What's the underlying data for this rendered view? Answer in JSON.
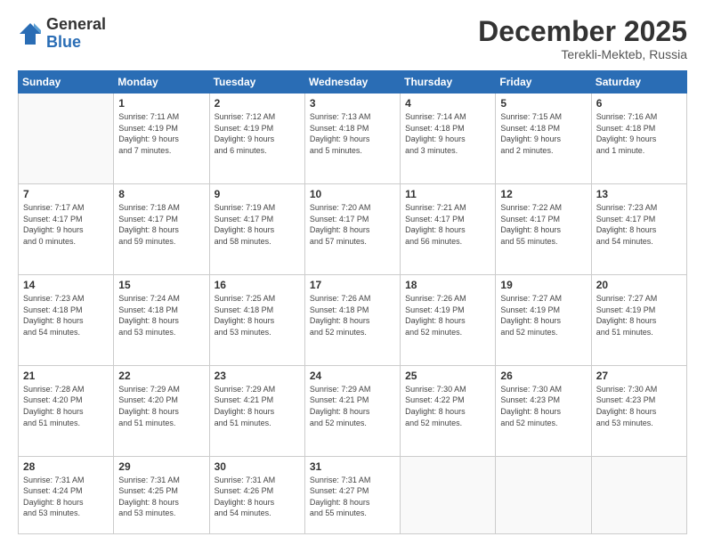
{
  "header": {
    "logo_general": "General",
    "logo_blue": "Blue",
    "month_title": "December 2025",
    "location": "Terekli-Mekteb, Russia"
  },
  "days_of_week": [
    "Sunday",
    "Monday",
    "Tuesday",
    "Wednesday",
    "Thursday",
    "Friday",
    "Saturday"
  ],
  "weeks": [
    [
      {
        "day": "",
        "info": ""
      },
      {
        "day": "1",
        "info": "Sunrise: 7:11 AM\nSunset: 4:19 PM\nDaylight: 9 hours\nand 7 minutes."
      },
      {
        "day": "2",
        "info": "Sunrise: 7:12 AM\nSunset: 4:19 PM\nDaylight: 9 hours\nand 6 minutes."
      },
      {
        "day": "3",
        "info": "Sunrise: 7:13 AM\nSunset: 4:18 PM\nDaylight: 9 hours\nand 5 minutes."
      },
      {
        "day": "4",
        "info": "Sunrise: 7:14 AM\nSunset: 4:18 PM\nDaylight: 9 hours\nand 3 minutes."
      },
      {
        "day": "5",
        "info": "Sunrise: 7:15 AM\nSunset: 4:18 PM\nDaylight: 9 hours\nand 2 minutes."
      },
      {
        "day": "6",
        "info": "Sunrise: 7:16 AM\nSunset: 4:18 PM\nDaylight: 9 hours\nand 1 minute."
      }
    ],
    [
      {
        "day": "7",
        "info": "Sunrise: 7:17 AM\nSunset: 4:17 PM\nDaylight: 9 hours\nand 0 minutes."
      },
      {
        "day": "8",
        "info": "Sunrise: 7:18 AM\nSunset: 4:17 PM\nDaylight: 8 hours\nand 59 minutes."
      },
      {
        "day": "9",
        "info": "Sunrise: 7:19 AM\nSunset: 4:17 PM\nDaylight: 8 hours\nand 58 minutes."
      },
      {
        "day": "10",
        "info": "Sunrise: 7:20 AM\nSunset: 4:17 PM\nDaylight: 8 hours\nand 57 minutes."
      },
      {
        "day": "11",
        "info": "Sunrise: 7:21 AM\nSunset: 4:17 PM\nDaylight: 8 hours\nand 56 minutes."
      },
      {
        "day": "12",
        "info": "Sunrise: 7:22 AM\nSunset: 4:17 PM\nDaylight: 8 hours\nand 55 minutes."
      },
      {
        "day": "13",
        "info": "Sunrise: 7:23 AM\nSunset: 4:17 PM\nDaylight: 8 hours\nand 54 minutes."
      }
    ],
    [
      {
        "day": "14",
        "info": "Sunrise: 7:23 AM\nSunset: 4:18 PM\nDaylight: 8 hours\nand 54 minutes."
      },
      {
        "day": "15",
        "info": "Sunrise: 7:24 AM\nSunset: 4:18 PM\nDaylight: 8 hours\nand 53 minutes."
      },
      {
        "day": "16",
        "info": "Sunrise: 7:25 AM\nSunset: 4:18 PM\nDaylight: 8 hours\nand 53 minutes."
      },
      {
        "day": "17",
        "info": "Sunrise: 7:26 AM\nSunset: 4:18 PM\nDaylight: 8 hours\nand 52 minutes."
      },
      {
        "day": "18",
        "info": "Sunrise: 7:26 AM\nSunset: 4:19 PM\nDaylight: 8 hours\nand 52 minutes."
      },
      {
        "day": "19",
        "info": "Sunrise: 7:27 AM\nSunset: 4:19 PM\nDaylight: 8 hours\nand 52 minutes."
      },
      {
        "day": "20",
        "info": "Sunrise: 7:27 AM\nSunset: 4:19 PM\nDaylight: 8 hours\nand 51 minutes."
      }
    ],
    [
      {
        "day": "21",
        "info": "Sunrise: 7:28 AM\nSunset: 4:20 PM\nDaylight: 8 hours\nand 51 minutes."
      },
      {
        "day": "22",
        "info": "Sunrise: 7:29 AM\nSunset: 4:20 PM\nDaylight: 8 hours\nand 51 minutes."
      },
      {
        "day": "23",
        "info": "Sunrise: 7:29 AM\nSunset: 4:21 PM\nDaylight: 8 hours\nand 51 minutes."
      },
      {
        "day": "24",
        "info": "Sunrise: 7:29 AM\nSunset: 4:21 PM\nDaylight: 8 hours\nand 52 minutes."
      },
      {
        "day": "25",
        "info": "Sunrise: 7:30 AM\nSunset: 4:22 PM\nDaylight: 8 hours\nand 52 minutes."
      },
      {
        "day": "26",
        "info": "Sunrise: 7:30 AM\nSunset: 4:23 PM\nDaylight: 8 hours\nand 52 minutes."
      },
      {
        "day": "27",
        "info": "Sunrise: 7:30 AM\nSunset: 4:23 PM\nDaylight: 8 hours\nand 53 minutes."
      }
    ],
    [
      {
        "day": "28",
        "info": "Sunrise: 7:31 AM\nSunset: 4:24 PM\nDaylight: 8 hours\nand 53 minutes."
      },
      {
        "day": "29",
        "info": "Sunrise: 7:31 AM\nSunset: 4:25 PM\nDaylight: 8 hours\nand 53 minutes."
      },
      {
        "day": "30",
        "info": "Sunrise: 7:31 AM\nSunset: 4:26 PM\nDaylight: 8 hours\nand 54 minutes."
      },
      {
        "day": "31",
        "info": "Sunrise: 7:31 AM\nSunset: 4:27 PM\nDaylight: 8 hours\nand 55 minutes."
      },
      {
        "day": "",
        "info": ""
      },
      {
        "day": "",
        "info": ""
      },
      {
        "day": "",
        "info": ""
      }
    ]
  ]
}
